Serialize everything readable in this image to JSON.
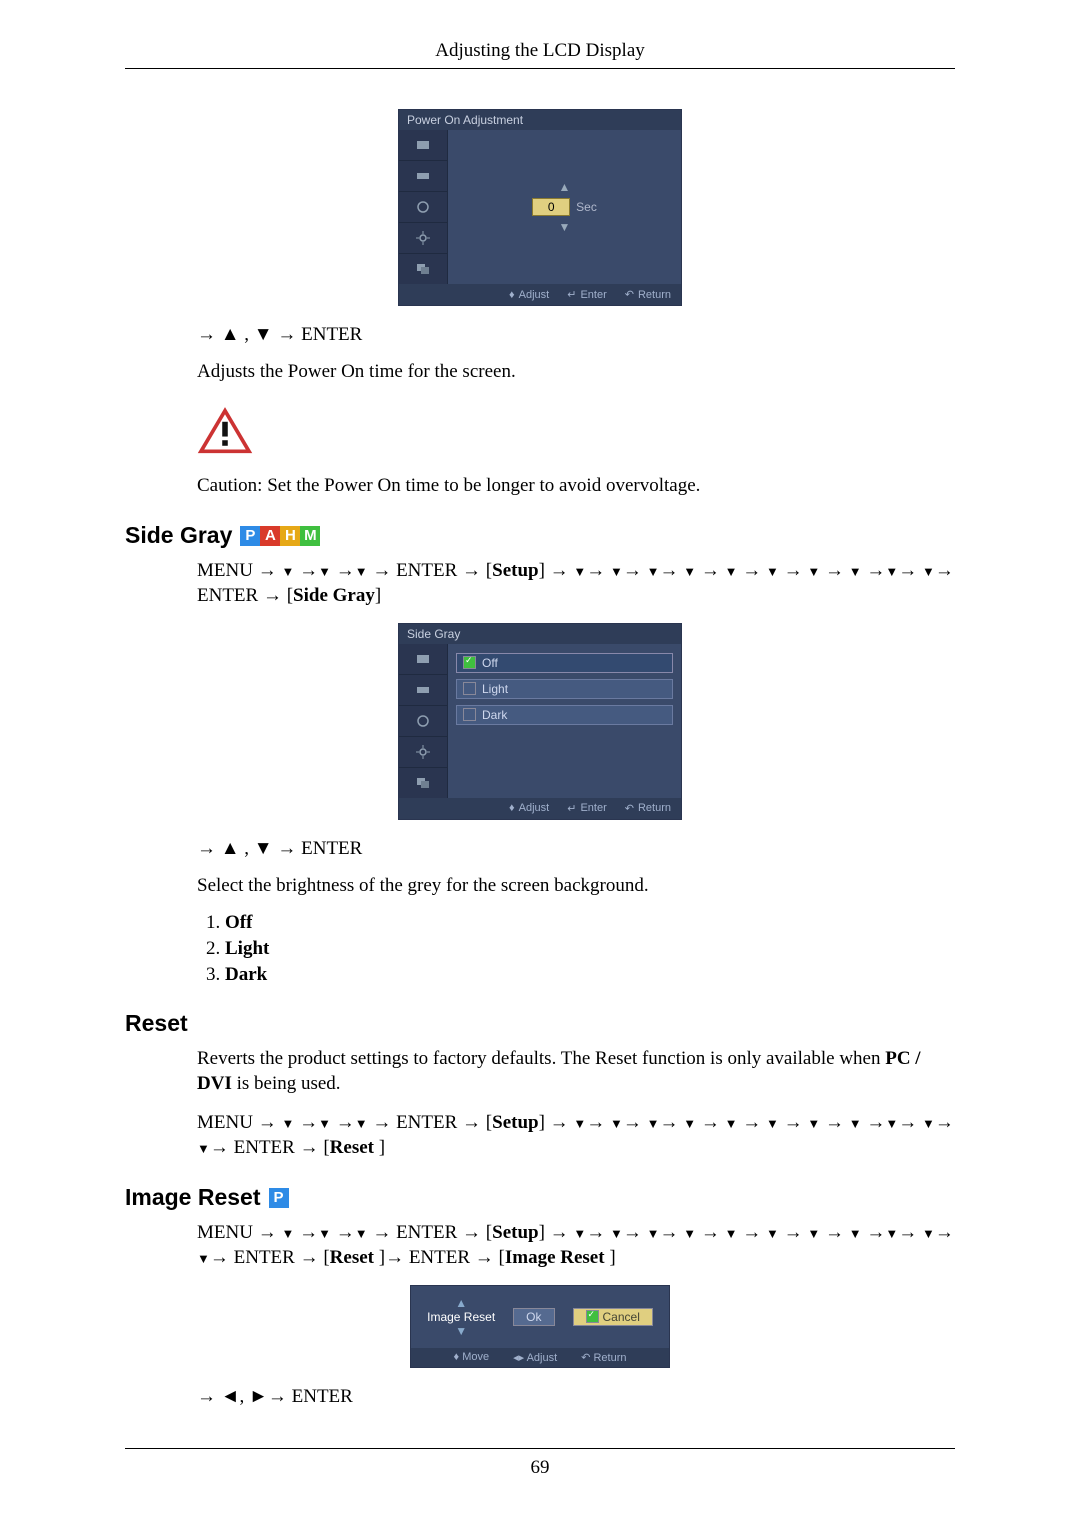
{
  "page": {
    "header": "Adjusting the LCD Display",
    "number": "69"
  },
  "osd_common": {
    "adjust": "Adjust",
    "enter": "Enter",
    "return": "Return",
    "move": "Move"
  },
  "power_on": {
    "osd_title": "Power On Adjustment",
    "value": "0",
    "unit": "Sec",
    "nav": "→ ▲ , ▼ → ENTER",
    "desc": "Adjusts the Power On time for the screen.",
    "caution": "Caution: Set the Power On time to be longer to avoid overvoltage."
  },
  "side_gray": {
    "heading": "Side Gray",
    "menu_path": "MENU → ▼ →▼ →▼ → ENTER → [Setup] → ▼→ ▼→ ▼→ ▼ → ▼ → ▼ → ▼ → ▼ →▼→ ▼→ ENTER → [Side Gray]",
    "osd_title": "Side Gray",
    "options": [
      "Off",
      "Light",
      "Dark"
    ],
    "nav": "→ ▲ , ▼ → ENTER",
    "desc": "Select the brightness of the grey for the screen background.",
    "list": {
      "1": "Off",
      "2": "Light",
      "3": "Dark"
    }
  },
  "reset": {
    "heading": "Reset",
    "desc_a": "Reverts the product settings to factory defaults. The Reset function is only available when ",
    "desc_bold": "PC / DVI",
    "desc_b": " is being used.",
    "menu_path": "MENU → ▼ →▼ →▼ → ENTER → [Setup] → ▼→ ▼→ ▼→ ▼ → ▼ → ▼ → ▼ → ▼ →▼→ ▼→ ▼→ ENTER → [Reset ]"
  },
  "image_reset": {
    "heading": "Image Reset",
    "menu_path": "MENU → ▼ →▼ →▼ → ENTER → [Setup] → ▼→ ▼→ ▼→ ▼ → ▼ → ▼ → ▼ → ▼ →▼→ ▼→ ▼→ ENTER → [Reset ]→ ENTER → [Image Reset ]",
    "dialog_title": "Image Reset",
    "ok": "Ok",
    "cancel": "Cancel",
    "nav": "→ ◄, ►→ ENTER"
  }
}
